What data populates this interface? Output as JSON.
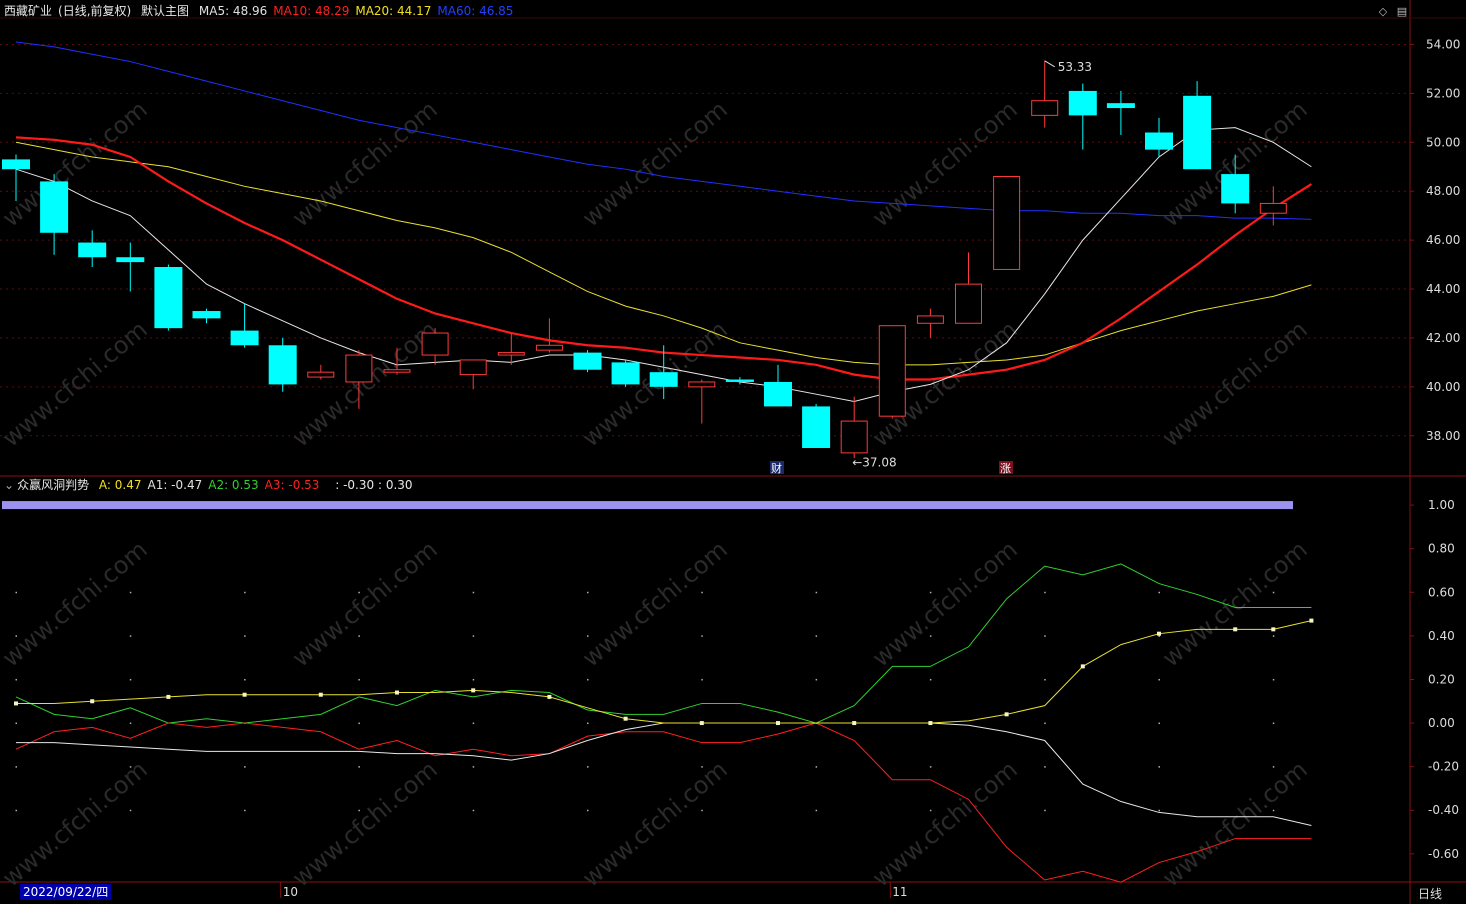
{
  "header": {
    "stock_name": "西藏矿业",
    "mode": "(日线,前复权)",
    "main_chart_label": "默认主图",
    "ma": [
      {
        "label": "MA5:",
        "value": "48.96",
        "color": "#e0e0e0"
      },
      {
        "label": "MA10:",
        "value": "48.29",
        "color": "#ff2020"
      },
      {
        "label": "MA20:",
        "value": "44.17",
        "color": "#f0e020"
      },
      {
        "label": "MA60:",
        "value": "46.85",
        "color": "#2040ff"
      }
    ]
  },
  "indicator_header": {
    "name": "众赢风洞判势",
    "values": [
      {
        "label": "A:",
        "value": "0.47",
        "color": "#f0e020"
      },
      {
        "label": "A1:",
        "value": "-0.47",
        "color": "#e0e0e0"
      },
      {
        "label": "A2:",
        "value": "0.53",
        "color": "#30d030"
      },
      {
        "label": "A3:",
        "value": "-0.53",
        "color": "#ff2020"
      }
    ],
    "extra": ": -0.30 : 0.30"
  },
  "icons": {
    "collapse_main": "diamond-icon",
    "settings_main": "panel-icon",
    "indicator_toggle": "chevron-down-icon"
  },
  "annotations": {
    "high_label": "53.33",
    "low_label": "37.08",
    "event_finance": "财",
    "event_limit": "涨"
  },
  "x_axis": {
    "current_date": "2022/09/22/四",
    "month_labels": [
      "10",
      "11"
    ],
    "period_label": "日线"
  },
  "price_axis_labels": [
    "54.00",
    "52.00",
    "50.00",
    "48.00",
    "46.00",
    "44.00",
    "42.00",
    "40.00",
    "38.00"
  ],
  "indicator_axis_labels": [
    "1.00",
    "0.80",
    "0.60",
    "0.40",
    "0.20",
    "0.00",
    "-0.20",
    "-0.40",
    "-0.60"
  ],
  "watermark": "www.cfchi.com",
  "chart_data": {
    "type": "candlestick",
    "price_range": [
      36.6,
      55.0
    ],
    "candles": [
      {
        "o": 49.3,
        "h": 49.5,
        "l": 47.6,
        "c": 48.9
      },
      {
        "o": 48.4,
        "h": 48.7,
        "l": 45.4,
        "c": 46.3
      },
      {
        "o": 45.9,
        "h": 46.4,
        "l": 44.9,
        "c": 45.3
      },
      {
        "o": 45.3,
        "h": 45.9,
        "l": 43.9,
        "c": 45.1
      },
      {
        "o": 44.9,
        "h": 45.0,
        "l": 42.3,
        "c": 42.4
      },
      {
        "o": 43.1,
        "h": 43.2,
        "l": 42.6,
        "c": 42.8
      },
      {
        "o": 42.3,
        "h": 43.4,
        "l": 41.6,
        "c": 41.7
      },
      {
        "o": 41.7,
        "h": 42.0,
        "l": 39.8,
        "c": 40.1
      },
      {
        "o": 40.4,
        "h": 40.9,
        "l": 40.3,
        "c": 40.6
      },
      {
        "o": 40.2,
        "h": 41.5,
        "l": 39.1,
        "c": 41.3
      },
      {
        "o": 40.6,
        "h": 41.6,
        "l": 40.5,
        "c": 40.7
      },
      {
        "o": 41.3,
        "h": 42.4,
        "l": 40.9,
        "c": 42.2
      },
      {
        "o": 40.5,
        "h": 41.1,
        "l": 39.9,
        "c": 41.1
      },
      {
        "o": 41.3,
        "h": 42.2,
        "l": 40.9,
        "c": 41.4
      },
      {
        "o": 41.5,
        "h": 42.8,
        "l": 41.4,
        "c": 41.7
      },
      {
        "o": 41.4,
        "h": 41.5,
        "l": 40.6,
        "c": 40.7
      },
      {
        "o": 41.0,
        "h": 41.1,
        "l": 40.0,
        "c": 40.1
      },
      {
        "o": 40.6,
        "h": 41.7,
        "l": 39.5,
        "c": 40.0
      },
      {
        "o": 40.0,
        "h": 40.3,
        "l": 38.5,
        "c": 40.2
      },
      {
        "o": 40.3,
        "h": 40.4,
        "l": 40.1,
        "c": 40.2
      },
      {
        "o": 40.2,
        "h": 40.9,
        "l": 39.3,
        "c": 39.2
      },
      {
        "o": 39.2,
        "h": 39.3,
        "l": 37.5,
        "c": 37.5
      },
      {
        "o": 37.3,
        "h": 39.6,
        "l": 37.08,
        "c": 38.6
      },
      {
        "o": 38.8,
        "h": 42.5,
        "l": 38.7,
        "c": 42.5
      },
      {
        "o": 42.6,
        "h": 43.2,
        "l": 42.0,
        "c": 42.9
      },
      {
        "o": 42.6,
        "h": 45.5,
        "l": 42.6,
        "c": 44.2
      },
      {
        "o": 44.8,
        "h": 48.6,
        "l": 44.8,
        "c": 48.6
      },
      {
        "o": 51.1,
        "h": 53.33,
        "l": 50.6,
        "c": 51.7
      },
      {
        "o": 52.1,
        "h": 52.4,
        "l": 49.7,
        "c": 51.1
      },
      {
        "o": 51.6,
        "h": 52.1,
        "l": 50.3,
        "c": 51.4
      },
      {
        "o": 50.4,
        "h": 51.0,
        "l": 49.4,
        "c": 49.7
      },
      {
        "o": 51.9,
        "h": 52.5,
        "l": 48.9,
        "c": 48.9
      },
      {
        "o": 48.7,
        "h": 49.5,
        "l": 47.1,
        "c": 47.5
      },
      {
        "o": 47.1,
        "h": 48.2,
        "l": 46.6,
        "c": 47.5
      }
    ],
    "ma5": [
      48.9,
      48.4,
      47.6,
      47.0,
      45.6,
      44.2,
      43.4,
      42.7,
      42.0,
      41.4,
      40.9,
      41.0,
      41.1,
      41.0,
      41.3,
      41.3,
      41.1,
      40.8,
      40.5,
      40.2,
      40.0,
      39.7,
      39.4,
      39.8,
      40.1,
      40.7,
      41.8,
      43.8,
      46.0,
      47.7,
      49.4,
      50.5,
      50.6,
      50.0,
      49.0
    ],
    "ma10": [
      50.2,
      50.1,
      49.9,
      49.4,
      48.4,
      47.5,
      46.7,
      46.0,
      45.2,
      44.4,
      43.6,
      43.0,
      42.6,
      42.2,
      41.9,
      41.7,
      41.6,
      41.4,
      41.3,
      41.2,
      41.1,
      40.9,
      40.5,
      40.3,
      40.3,
      40.5,
      40.7,
      41.1,
      41.8,
      42.8,
      43.9,
      45.0,
      46.2,
      47.3,
      48.29
    ],
    "ma20": [
      50.0,
      49.7,
      49.4,
      49.2,
      49.0,
      48.6,
      48.2,
      47.9,
      47.6,
      47.2,
      46.8,
      46.5,
      46.1,
      45.5,
      44.7,
      43.9,
      43.3,
      42.9,
      42.4,
      41.8,
      41.5,
      41.2,
      41.0,
      40.9,
      40.9,
      41.0,
      41.1,
      41.3,
      41.8,
      42.3,
      42.7,
      43.1,
      43.4,
      43.7,
      44.17
    ],
    "ma60": [
      54.1,
      53.9,
      53.6,
      53.3,
      52.9,
      52.5,
      52.1,
      51.7,
      51.3,
      50.9,
      50.6,
      50.3,
      50.0,
      49.7,
      49.4,
      49.1,
      48.9,
      48.6,
      48.4,
      48.2,
      48.0,
      47.8,
      47.6,
      47.5,
      47.4,
      47.3,
      47.2,
      47.2,
      47.1,
      47.1,
      47.0,
      47.0,
      46.9,
      46.9,
      46.85
    ],
    "indicator_range": [
      -0.72,
      1.06
    ],
    "A": [
      0.09,
      0.09,
      0.1,
      0.11,
      0.12,
      0.13,
      0.13,
      0.13,
      0.13,
      0.13,
      0.14,
      0.14,
      0.15,
      0.14,
      0.12,
      0.07,
      0.02,
      0.0,
      0.0,
      0.0,
      0.0,
      0.0,
      0.0,
      0.0,
      0.0,
      0.01,
      0.04,
      0.08,
      0.26,
      0.36,
      0.41,
      0.43,
      0.43,
      0.43,
      0.47
    ],
    "A1": [
      -0.09,
      -0.09,
      -0.1,
      -0.11,
      -0.12,
      -0.13,
      -0.13,
      -0.13,
      -0.13,
      -0.13,
      -0.14,
      -0.14,
      -0.15,
      -0.17,
      -0.14,
      -0.08,
      -0.03,
      0.0,
      0.0,
      0.0,
      0.0,
      0.0,
      0.0,
      0.0,
      0.0,
      -0.01,
      -0.04,
      -0.08,
      -0.28,
      -0.36,
      -0.41,
      -0.43,
      -0.43,
      -0.43,
      -0.47
    ],
    "A2": [
      0.12,
      0.04,
      0.02,
      0.07,
      0.0,
      0.02,
      0.0,
      0.02,
      0.04,
      0.12,
      0.08,
      0.15,
      0.12,
      0.15,
      0.14,
      0.06,
      0.04,
      0.04,
      0.09,
      0.09,
      0.05,
      0.0,
      0.08,
      0.26,
      0.26,
      0.35,
      0.57,
      0.72,
      0.68,
      0.73,
      0.64,
      0.59,
      0.53,
      0.53,
      0.53
    ],
    "A3": [
      -0.12,
      -0.04,
      -0.02,
      -0.07,
      0.0,
      -0.02,
      0.0,
      -0.02,
      -0.04,
      -0.12,
      -0.08,
      -0.15,
      -0.12,
      -0.15,
      -0.14,
      -0.06,
      -0.04,
      -0.04,
      -0.09,
      -0.09,
      -0.05,
      0.0,
      -0.08,
      -0.26,
      -0.26,
      -0.35,
      -0.57,
      -0.72,
      -0.68,
      -0.73,
      -0.64,
      -0.59,
      -0.53,
      -0.53,
      -0.53
    ],
    "marker_every": 2
  }
}
